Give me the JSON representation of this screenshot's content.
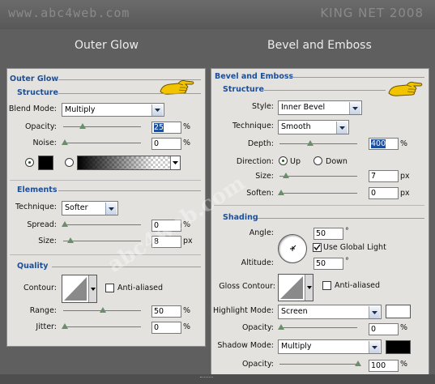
{
  "header": {
    "site": "www.abc4web.com",
    "brand": "KING NET 2008"
  },
  "watermark": "abc4web.com",
  "outer_glow": {
    "page_title": "Outer Glow",
    "panel_title": "Outer Glow",
    "structure": {
      "title": "Structure",
      "blend_mode_label": "Blend Mode:",
      "blend_mode_value": "Multiply",
      "opacity_label": "Opacity:",
      "opacity_value": "25",
      "noise_label": "Noise:",
      "noise_value": "0",
      "unit": "%"
    },
    "elements": {
      "title": "Elements",
      "technique_label": "Technique:",
      "technique_value": "Softer",
      "spread_label": "Spread:",
      "spread_value": "0",
      "spread_unit": "%",
      "size_label": "Size:",
      "size_value": "8",
      "size_unit": "px"
    },
    "quality": {
      "title": "Quality",
      "contour_label": "Contour:",
      "anti_aliased_label": "Anti-aliased",
      "range_label": "Range:",
      "range_value": "50",
      "jitter_label": "Jitter:",
      "jitter_value": "0",
      "unit": "%"
    }
  },
  "bevel_emboss": {
    "page_title": "Bevel and Emboss",
    "panel_title": "Bevel and Emboss",
    "structure": {
      "title": "Structure",
      "style_label": "Style:",
      "style_value": "Inner Bevel",
      "technique_label": "Technique:",
      "technique_value": "Smooth",
      "depth_label": "Depth:",
      "depth_value": "400",
      "depth_unit": "%",
      "direction_label": "Direction:",
      "direction_up": "Up",
      "direction_down": "Down",
      "size_label": "Size:",
      "size_value": "7",
      "size_unit": "px",
      "soften_label": "Soften:",
      "soften_value": "0",
      "soften_unit": "px"
    },
    "shading": {
      "title": "Shading",
      "angle_label": "Angle:",
      "angle_value": "50",
      "degree": "°",
      "use_global_light_label": "Use Global Light",
      "altitude_label": "Altitude:",
      "altitude_value": "50",
      "gloss_contour_label": "Gloss Contour:",
      "anti_aliased_label": "Anti-aliased",
      "highlight_mode_label": "Highlight Mode:",
      "highlight_mode_value": "Screen",
      "highlight_opacity_label": "Opacity:",
      "highlight_opacity_value": "0",
      "shadow_mode_label": "Shadow Mode:",
      "shadow_mode_value": "Multiply",
      "shadow_opacity_label": "Opacity:",
      "shadow_opacity_value": "100",
      "unit": "%"
    }
  },
  "colors": {
    "section_header": "#1e4f95",
    "highlight_color": "#ffffff",
    "shadow_color": "#000000",
    "glow_color": "#000000",
    "selection": "#1d4fa0"
  }
}
